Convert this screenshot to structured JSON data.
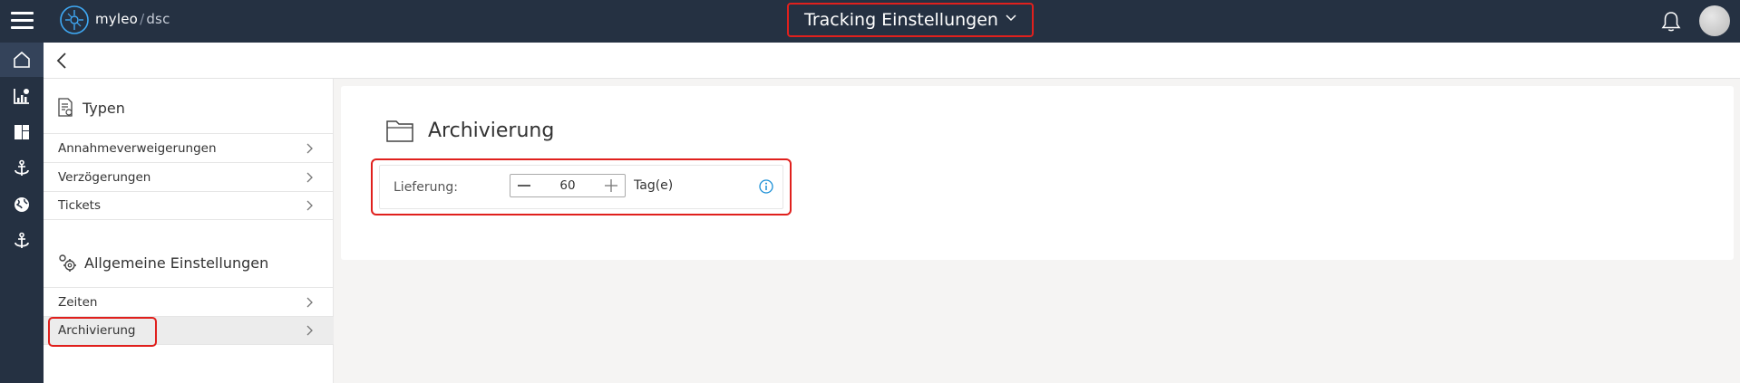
{
  "app": {
    "brand_name": "myleo",
    "brand_separator": "/",
    "brand_sub": "dsc",
    "title": "Tracking Einstellungen"
  },
  "header_icons": [
    "menu-icon",
    "bell-icon",
    "avatar"
  ],
  "rail": [
    "home-icon",
    "analytics-icon",
    "dashboard-icon",
    "anchor-icon",
    "globe-icon",
    "anchor-icon"
  ],
  "sidebar": {
    "sections": [
      {
        "title": "Typen",
        "icon": "document-settings-icon",
        "items": [
          {
            "label": "Annahmeverweigerungen"
          },
          {
            "label": "Verzögerungen"
          },
          {
            "label": "Tickets"
          }
        ]
      },
      {
        "title": "Allgemeine Einstellungen",
        "icon": "gears-icon",
        "items": [
          {
            "label": "Zeiten"
          },
          {
            "label": "Archivierung",
            "selected": true
          }
        ]
      }
    ]
  },
  "content": {
    "title": "Archivierung",
    "field": {
      "label": "Lieferung:",
      "value": "60",
      "unit": "Tag(e)"
    }
  },
  "colors": {
    "header_bg": "#253142",
    "highlight": "#e0201d",
    "info": "#1a8fd6"
  }
}
